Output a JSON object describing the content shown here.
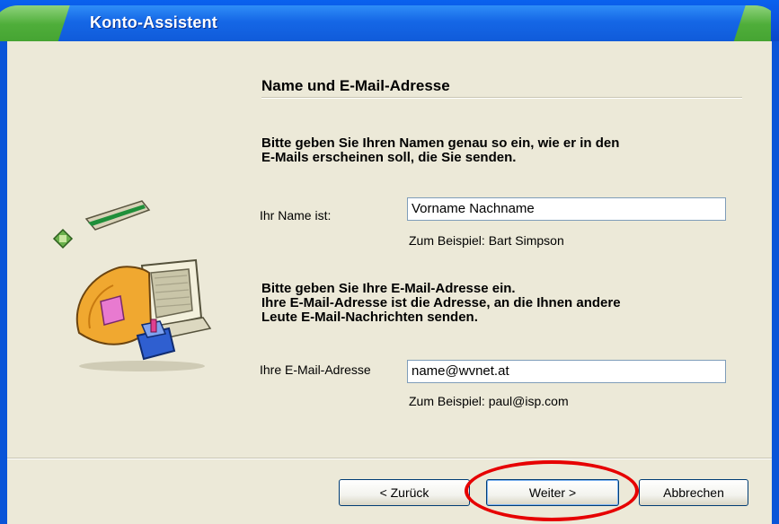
{
  "window": {
    "title": "Konto-Assistent"
  },
  "page": {
    "heading": "Name und E-Mail-Adresse",
    "name_section": {
      "instruction": "Bitte geben Sie Ihren Namen genau so ein, wie er in den\nE-Mails erscheinen soll, die Sie senden.",
      "label": "Ihr Name ist:",
      "value": "Vorname Nachname",
      "hint": "Zum Beispiel: Bart Simpson"
    },
    "email_section": {
      "instruction": "Bitte geben Sie Ihre E-Mail-Adresse ein.\nIhre E-Mail-Adresse ist die Adresse, an die Ihnen andere\nLeute E-Mail-Nachrichten senden.",
      "label": "Ihre E-Mail-Adresse",
      "value": "name@wvnet.at",
      "hint": "Zum Beispiel: paul@isp.com"
    }
  },
  "buttons": {
    "back": "< Zurück",
    "next": "Weiter >",
    "cancel": "Abbrechen"
  },
  "icons": {
    "wizard_illustration": "computer-mail-wizard-icon"
  },
  "colors": {
    "titlebar_blue": "#0b56e3",
    "titlebar_green": "#4fae3a",
    "panel_bg": "#ece9d8",
    "highlight": "#e60000"
  }
}
